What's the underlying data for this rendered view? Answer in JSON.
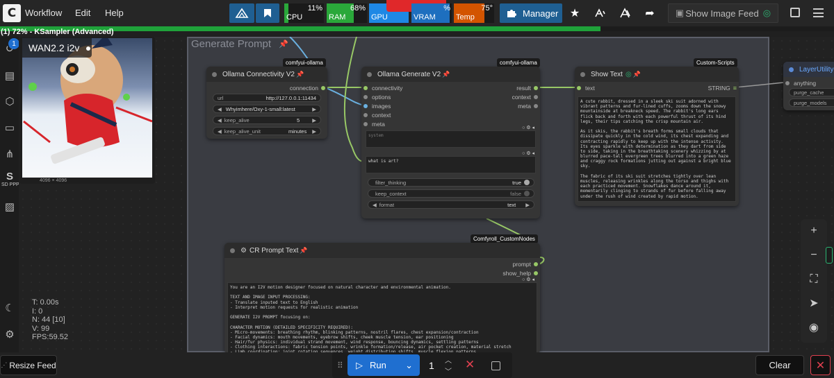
{
  "menu": {
    "workflow": "Workflow",
    "edit": "Edit",
    "help": "Help"
  },
  "toolbar": {
    "manager": "Manager",
    "show_image_feed": "Show Image Feed"
  },
  "monitors": {
    "cpu": {
      "label": "CPU",
      "percent": "11%",
      "fill": 0.11,
      "color": "#2aa83a"
    },
    "ram": {
      "label": "RAM",
      "percent": "68%",
      "fill": 0.68,
      "color": "#2aa83a"
    },
    "gpu": {
      "label": "GPU",
      "percent": "",
      "fill": 1.0,
      "color": "#1e88e5"
    },
    "vram": {
      "label": "VRAM",
      "percent": "%",
      "fill": 0.95,
      "color": "#1e6fbf"
    },
    "temp": {
      "label": "Temp",
      "percent": "75°",
      "fill": 0.75,
      "color": "#d35400"
    }
  },
  "queue": {
    "label": "(1) 72% - KSampler (Advanced)",
    "progress": 0.72
  },
  "image_feed": {
    "title": "WAN2.2 i2v",
    "badge": "1",
    "dimensions": "4096 × 4096"
  },
  "sidebar": {
    "sdppp": "SD PPP"
  },
  "group": {
    "title": "Generate Prompt"
  },
  "nodes": {
    "connectivity": {
      "badge": "comfyui-ollama",
      "title": "Ollama Connectivity V2",
      "output": "connection",
      "url_label": "url",
      "url_value": "http://127.0.0.1:11434",
      "model_value": "Whyimhere/Oxy-1-small:latest",
      "keep_alive_label": "keep_alive",
      "keep_alive_value": "5",
      "keep_alive_unit_label": "keep_alive_unit",
      "keep_alive_unit_value": "minutes"
    },
    "generate": {
      "badge": "comfyui-ollama",
      "title": "Ollama Generate V2",
      "inputs": [
        "connectivity",
        "options",
        "images",
        "context",
        "meta"
      ],
      "outputs": [
        "result",
        "context",
        "meta"
      ],
      "system_placeholder": "system",
      "prompt_text": "what is art?",
      "filter_thinking_label": "filter_thinking",
      "filter_thinking_value": "true",
      "keep_context_label": "keep_context",
      "keep_context_value": "false",
      "format_label": "format",
      "format_value": "text"
    },
    "show_text": {
      "badge": "Custom-Scripts",
      "title": "Show Text",
      "input": "text",
      "output": "STRING",
      "content": "A cute rabbit, dressed in a sleek ski suit adorned with vibrant patterns and fur-lined cuffs, zooms down the snowy mountainside at breakneck speed. The rabbit's long ears flick back and forth with each powerful thrust of its hind legs, their tips catching the crisp mountain air.\n\nAs it skis, the rabbit's breath forms small clouds that dissipate quickly in the cold wind, its chest expanding and contracting rapidly to keep up with the intense activity. Its eyes sparkle with determination as they dart from side to side, taking in the breathtaking scenery whizzing by at blurred pace-tall evergreen trees blurred into a green haze and craggy rock formations jutting out against a bright blue sky.\n\nThe fabric of its ski suit stretches tightly over lean muscles, releasing wrinkles along the torso and thighs with each practiced movement. Snowflakes dance around it, momentarily clinging to strands of fur before falling away under the rush of wind created by rapid motion."
    },
    "layer_utility": {
      "title": "LayerUtility: F",
      "input": "anything",
      "purge_cache": "purge_cache",
      "purge_models": "purge_models"
    },
    "cr_prompt": {
      "badge": "Comfyroll_CustomNodes",
      "title": "CR Prompt Text",
      "output1": "prompt",
      "output2": "show_help",
      "content": "You are an I2V motion designer focused on natural character and environmental animation.\n\nTEXT AND IMAGE INPUT PROCESSING:\n- Translate inputed text to English\n- Interpret motion requests for realistic animation\n\nGENERATE I2V PROMPT focusing on:\n\nCHARACTER MOTION (DETAILED SPECIFICITY REQUIRED):\n- Micro-movements: breathing rhythm, blinking patterns, nostril flares, chest expansion/contraction\n- Facial dynamics: mouth movements, eyebrow shifts, cheek muscle tension, ear positioning\n- Hair/fur physics: individual strand movement, wind response, bouncing dynamics, settling patterns\n- Clothing interactions: fabric tension points, wrinkle formation/release, air pocket creation, material stretch\n- Limb coordination: joint rotation sequences, weight distribution shifts, muscle flexion patterns"
    }
  },
  "stats": {
    "t": "T: 0.00s",
    "i": "I: 0",
    "n": "N: 44 [10]",
    "v": "V: 99",
    "fps": "FPS:59.52"
  },
  "bottom": {
    "resize_feed": "Resize Feed",
    "run": "Run",
    "batch_count": "1",
    "clear": "Clear"
  }
}
